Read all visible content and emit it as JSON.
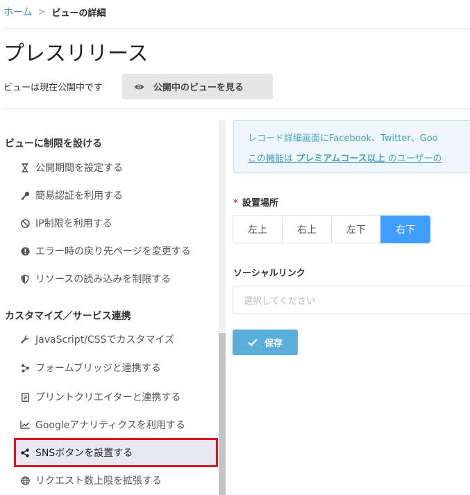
{
  "breadcrumb": {
    "home": "ホーム",
    "separator": ">",
    "current": "ビューの詳細"
  },
  "page": {
    "title": "プレスリリース"
  },
  "status": {
    "text": "ビューは現在公開中です",
    "view_button": "公開中のビューを見る"
  },
  "sidebar": {
    "sections": [
      {
        "title": "ビューに制限を設ける",
        "items": [
          {
            "label": "公開期間を設定する",
            "icon": "hourglass-icon"
          },
          {
            "label": "簡易認証を利用する",
            "icon": "key-icon"
          },
          {
            "label": "IP制限を利用する",
            "icon": "ban-icon"
          },
          {
            "label": "エラー時の戻り先ページを変更する",
            "icon": "alert-icon"
          },
          {
            "label": "リソースの読み込みを制限する",
            "icon": "shield-icon"
          }
        ]
      },
      {
        "title": "カスタマイズ／サービス連携",
        "items": [
          {
            "label": "JavaScript/CSSでカスタマイズ",
            "icon": "wrench-icon"
          },
          {
            "label": "フォームブリッジと連携する",
            "icon": "connect-icon"
          },
          {
            "label": "プリントクリエイターと連携する",
            "icon": "document-icon"
          },
          {
            "label": "Googleアナリティクスを利用する",
            "icon": "chart-icon"
          },
          {
            "label": "SNSボタンを設置する",
            "icon": "share-icon",
            "active": true
          },
          {
            "label": "リクエスト数上限を拡張する",
            "icon": "globe-icon"
          }
        ]
      }
    ]
  },
  "info": {
    "line1": "レコード詳細画面にFacebook、Twitter、Goo",
    "line2_prefix": "この機能は ",
    "line2_bold": "プレミアムコース以上",
    "line2_suffix": " のユーザーの"
  },
  "placement": {
    "label": "設置場所",
    "required_mark": "*",
    "options": [
      "左上",
      "右上",
      "左下",
      "右下"
    ],
    "selected": "右下"
  },
  "social_link": {
    "label": "ソーシャルリンク",
    "placeholder": "選択してください"
  },
  "save_button": {
    "label": "保存"
  },
  "colors": {
    "accent": "#409eff",
    "link": "#3d8fd8",
    "save": "#5aaedc",
    "highlight": "#e0141c"
  }
}
